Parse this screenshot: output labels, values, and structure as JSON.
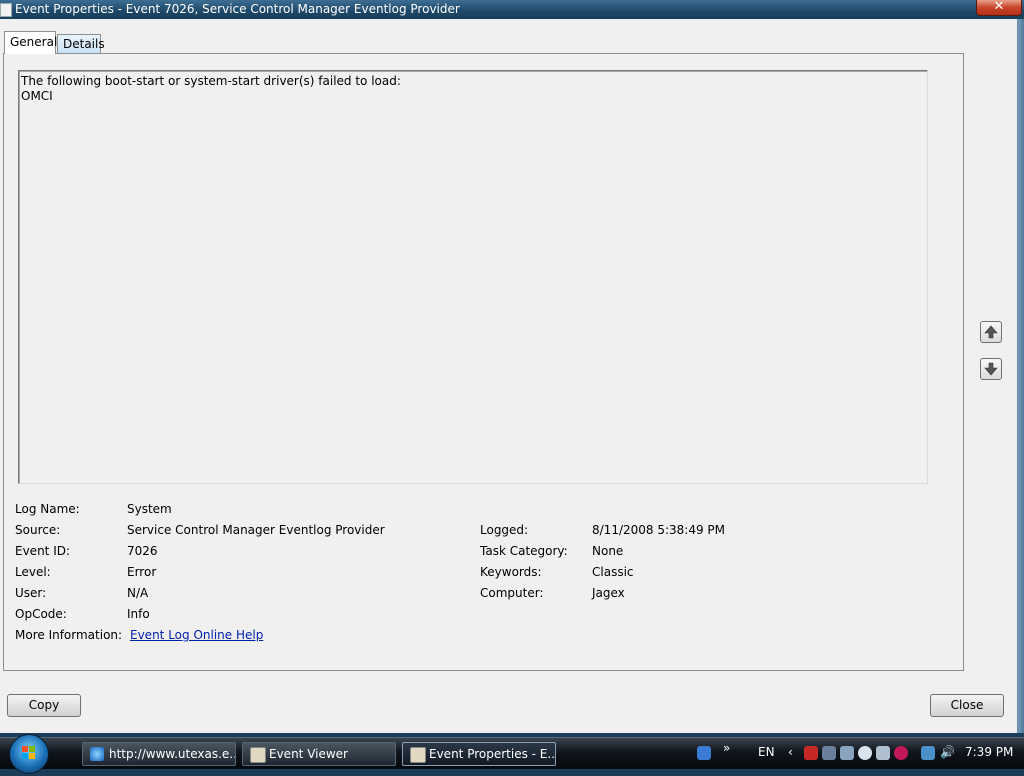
{
  "window": {
    "title": "Event Properties - Event 7026, Service Control Manager Eventlog Provider",
    "close_glyph": "✕"
  },
  "tabs": [
    {
      "label": "General"
    },
    {
      "label": "Details"
    }
  ],
  "description": {
    "line1": "The following boot-start or system-start driver(s) failed to load:",
    "line2": "OMCI"
  },
  "properties": {
    "log_name": {
      "label": "Log Name:",
      "value": "System"
    },
    "source": {
      "label": "Source:",
      "value": "Service Control Manager Eventlog Provider"
    },
    "event_id": {
      "label": "Event ID:",
      "value": "7026"
    },
    "level": {
      "label": "Level:",
      "value": "Error"
    },
    "user": {
      "label": "User:",
      "value": "N/A"
    },
    "opcode": {
      "label": "OpCode:",
      "value": "Info"
    },
    "more_info": {
      "label": "More Information:",
      "value": "Event Log Online Help"
    },
    "logged": {
      "label": "Logged:",
      "value": "8/11/2008 5:38:49 PM"
    },
    "task_category": {
      "label": "Task Category:",
      "value": "None"
    },
    "keywords": {
      "label": "Keywords:",
      "value": "Classic"
    },
    "computer": {
      "label": "Computer:",
      "value": "Jagex"
    }
  },
  "buttons": {
    "copy": "Copy",
    "close": "Close"
  },
  "taskbar": {
    "tasks": [
      {
        "label": "http://www.utexas.e...",
        "icon": "internet-explorer-icon"
      },
      {
        "label": "Event Viewer",
        "icon": "event-viewer-icon"
      },
      {
        "label": "Event Properties - E...",
        "icon": "event-properties-icon"
      }
    ],
    "language": "EN",
    "clock": "7:39 PM"
  },
  "colors": {
    "link": "#0022aa",
    "titlebar": "#1f4a6b",
    "close_button": "#c8462a"
  }
}
